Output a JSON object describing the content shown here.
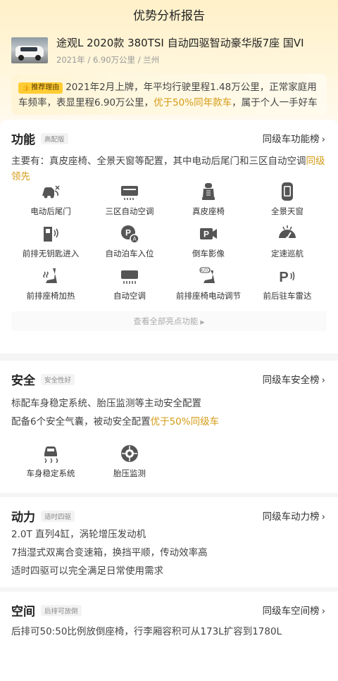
{
  "header": {
    "title": "优势分析报告"
  },
  "car": {
    "name": "途观L 2020款 380TSI 自动四驱智动豪华版7座 国VI",
    "meta": "2021年 / 6.90万公里 / 兰州"
  },
  "reason": {
    "tag": "推荐理由",
    "text_before": "2021年2月上牌，年平均行驶里程1.48万公里，正常家庭用车频率，表显里程6.90万公里，",
    "text_highlight": "优于50%同年款车",
    "text_after": "，属于个人一手好车"
  },
  "function": {
    "title": "功能",
    "badge": "高配版",
    "link": "同级车功能榜",
    "desc_before": "主要有：真皮座椅、全景天窗等配置，其中电动后尾门和三区自动空调",
    "desc_highlight": "同级领先",
    "features": [
      {
        "label": "电动后尾门",
        "icon": "power-tailgate-icon"
      },
      {
        "label": "三区自动空调",
        "icon": "tri-zone-ac-icon"
      },
      {
        "label": "真皮座椅",
        "icon": "leather-seat-icon"
      },
      {
        "label": "全景天窗",
        "icon": "panoramic-sunroof-icon"
      },
      {
        "label": "前排无钥匙进入",
        "icon": "keyless-entry-icon"
      },
      {
        "label": "自动泊车入位",
        "icon": "auto-parking-icon"
      },
      {
        "label": "倒车影像",
        "icon": "reverse-camera-icon"
      },
      {
        "label": "定速巡航",
        "icon": "cruise-control-icon"
      },
      {
        "label": "前排座椅加热",
        "icon": "seat-heating-icon"
      },
      {
        "label": "自动空调",
        "icon": "auto-ac-icon"
      },
      {
        "label": "前排座椅电动调节",
        "icon": "power-seat-adjust-icon"
      },
      {
        "label": "前后驻车雷达",
        "icon": "parking-radar-icon"
      }
    ],
    "view_all": "查看全部亮点功能"
  },
  "safety": {
    "title": "安全",
    "badge": "安全性好",
    "link": "同级车安全榜",
    "line1": "标配车身稳定系统、胎压监测等主动安全配置",
    "line2_before": "配备6个安全气囊，被动安全配置",
    "line2_highlight": "优于50%同级车",
    "features": [
      {
        "label": "车身稳定系统",
        "icon": "stability-control-icon"
      },
      {
        "label": "胎压监测",
        "icon": "tire-pressure-icon"
      }
    ]
  },
  "power": {
    "title": "动力",
    "badge": "适时四驱",
    "link": "同级车动力榜",
    "lines": [
      "2.0T 直列4缸，涡轮增压发动机",
      "7挡湿式双离合变速箱，换挡平顺，传动效率高",
      "适时四驱可以完全满足日常使用需求"
    ]
  },
  "space": {
    "title": "空间",
    "badge": "后排可放倒",
    "link": "同级车空间榜",
    "line": "后排可50:50比例放倒座椅，行李厢容积可从173L扩容到1780L"
  },
  "colors": {
    "accent": "#d49b15",
    "tag": "#ffcc33",
    "header_bg": "#fff0c8"
  }
}
